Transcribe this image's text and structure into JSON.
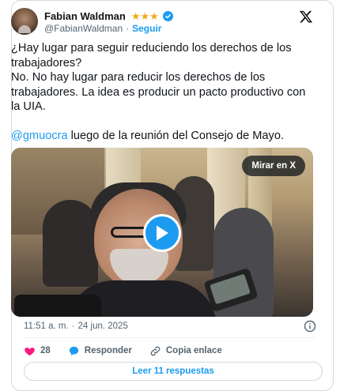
{
  "author": {
    "name": "Fabian Waldman",
    "handle": "@FabianWaldman",
    "separator": "·",
    "follow_label": "Seguir",
    "stars": "★★★"
  },
  "tweet": {
    "line1": "¿Hay lugar para seguir reduciendo los derechos de los trabajadores?",
    "line2": "No. No hay lugar para reducir los derechos de los trabajadores. La idea es producir un pacto productivo con la UIA.",
    "mention": "@gmuocra",
    "line3_rest": " luego de la reunión del Consejo de Mayo."
  },
  "media": {
    "watch_label": "Mirar en X"
  },
  "meta": {
    "time": "11:51 a. m.",
    "separator": "·",
    "date": "24 jun. 2025"
  },
  "actions": {
    "like_count": "28",
    "reply_label": "Responder",
    "copy_label": "Copia enlace"
  },
  "replies_button": "Leer 11 respuestas",
  "colors": {
    "accent": "#1d9bf0",
    "like": "#f91880",
    "star": "#f1a91b",
    "text": "#0f1419",
    "muted": "#536471"
  }
}
